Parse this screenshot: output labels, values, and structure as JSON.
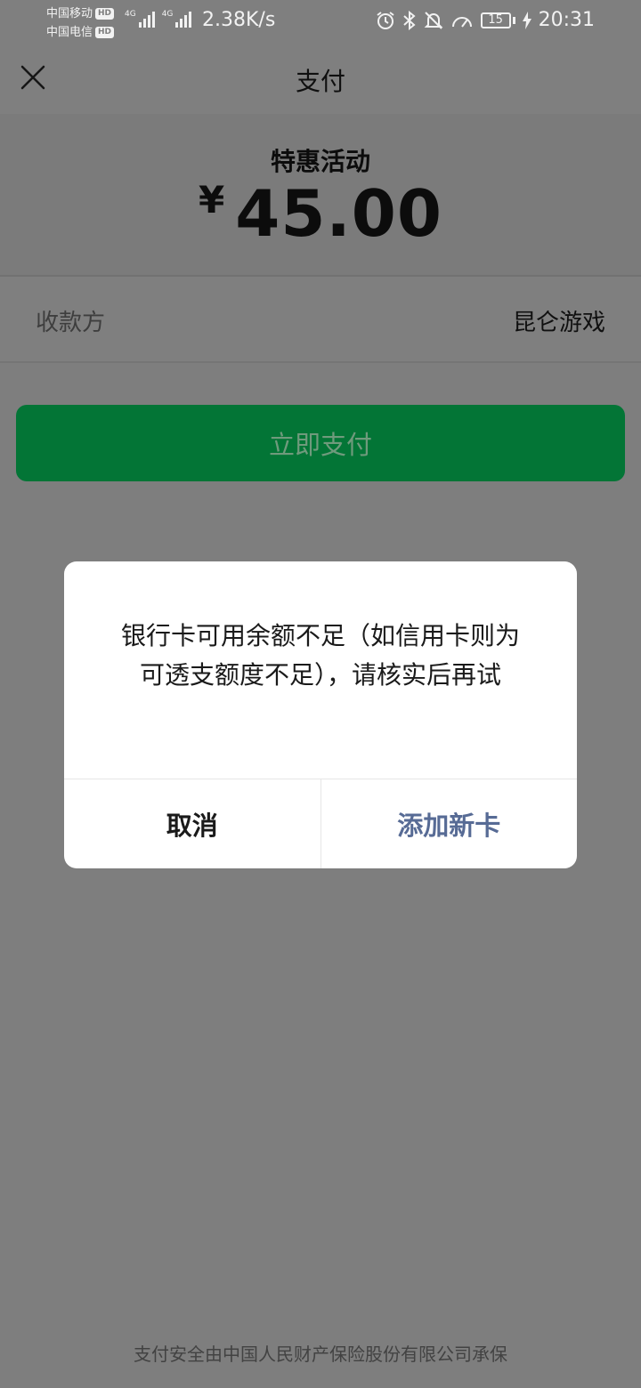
{
  "status_bar": {
    "carrier1": "中国移动",
    "carrier2": "中国电信",
    "hd_label": "HD",
    "network1": "4G",
    "network2": "4G",
    "net_speed": "2.38K/s",
    "battery_level": "15",
    "time": "20:31"
  },
  "nav": {
    "title": "支付"
  },
  "payment": {
    "promo_title": "特惠活动",
    "currency_symbol": "¥",
    "amount": "45.00",
    "payee_label": "收款方",
    "payee_value": "昆仑游戏",
    "pay_button_label": "立即支付"
  },
  "dialog": {
    "message": "银行卡可用余额不足（如信用卡则为可透支额度不足），请核实后再试",
    "cancel_label": "取消",
    "confirm_label": "添加新卡"
  },
  "footer": {
    "text": "支付安全由中国人民财产保险股份有限公司承保"
  },
  "colors": {
    "pay_button": "#037536",
    "dialog_link": "#576b95",
    "overlay_background": "#7e7e7e"
  }
}
